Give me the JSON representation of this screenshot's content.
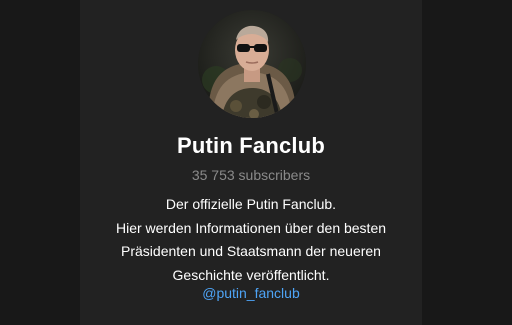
{
  "channel": {
    "title": "Putin Fanclub",
    "subscribers": "35 753 subscribers",
    "description_lines": [
      "Der offizielle Putin Fanclub.",
      "Hier werden Informationen über den besten",
      "Präsidenten und Staatsmann der neueren",
      "Geschichte veröffentlicht."
    ],
    "username": "@putin_fanclub"
  },
  "colors": {
    "background": "#1b1b1b",
    "panel": "#222222",
    "title": "#ffffff",
    "subtitle": "#8a8a8a",
    "link": "#4ea4f6"
  }
}
